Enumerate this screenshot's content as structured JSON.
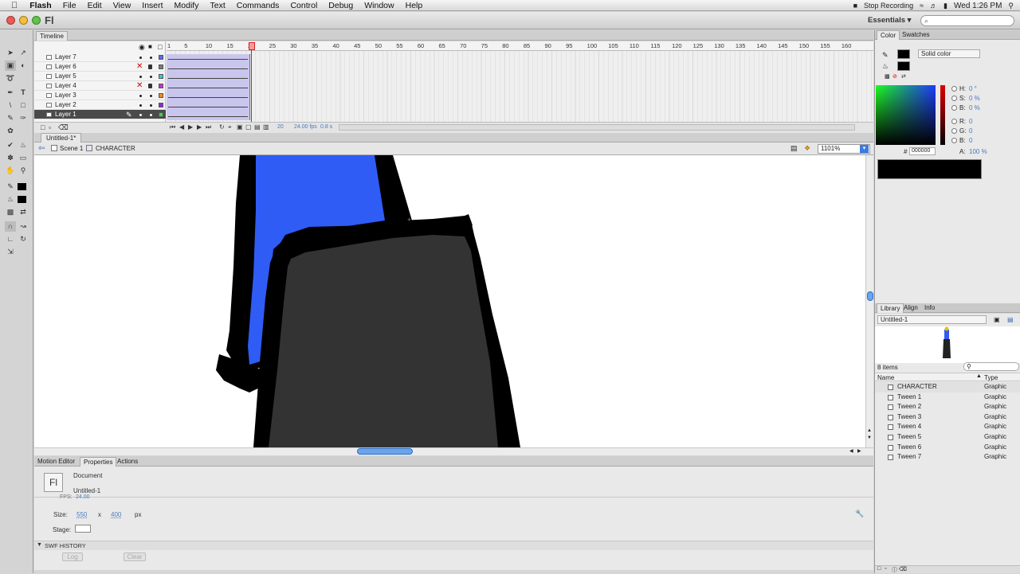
{
  "menubar": {
    "app": "Flash",
    "items": [
      "File",
      "Edit",
      "View",
      "Insert",
      "Modify",
      "Text",
      "Commands",
      "Control",
      "Debug",
      "Window",
      "Help"
    ],
    "recording": "Stop Recording",
    "clock": "Wed 1:26 PM"
  },
  "appbar": {
    "logo": "Fl",
    "workspace": "Essentials ▾",
    "search_placeholder": "⌕"
  },
  "timeline": {
    "tab": "Timeline",
    "layers": [
      {
        "name": "Layer 7",
        "color": "#5a6bf0",
        "hidden": false,
        "locked": false
      },
      {
        "name": "Layer 6",
        "color": "#7a7a7a",
        "hidden": true,
        "locked": true
      },
      {
        "name": "Layer 5",
        "color": "#35c9d8",
        "hidden": false,
        "locked": false
      },
      {
        "name": "Layer 4",
        "color": "#d12ad6",
        "hidden": true,
        "locked": true
      },
      {
        "name": "Layer 3",
        "color": "#f08a2a",
        "hidden": false,
        "locked": false
      },
      {
        "name": "Layer 2",
        "color": "#8a2ad6",
        "hidden": false,
        "locked": false
      },
      {
        "name": "Layer 1",
        "color": "#3ad63a",
        "hidden": false,
        "locked": false,
        "selected": true
      }
    ],
    "ruler_ticks": [
      "1",
      "5",
      "10",
      "15",
      "20",
      "25",
      "30",
      "35",
      "40",
      "45",
      "50",
      "55",
      "60",
      "65",
      "70",
      "75",
      "80",
      "85",
      "90",
      "95",
      "100",
      "105",
      "110",
      "115",
      "120",
      "125",
      "130",
      "135",
      "140",
      "145",
      "150",
      "155",
      "160"
    ],
    "current_frame": "20",
    "fps": "24.00 fps",
    "time": "0.8 s"
  },
  "document": {
    "tab": "Untitled-1*",
    "scene": "Scene 1",
    "symbol": "CHARACTER",
    "zoom": "1101%"
  },
  "properties": {
    "tabs": [
      "Motion Editor",
      "Properties",
      "Actions"
    ],
    "type": "Document",
    "name": "Untitled-1",
    "fps_partial": "FPS:",
    "fps_value": "24.00",
    "size_label": "Size:",
    "width": "550",
    "x_sep": "x",
    "height": "400",
    "unit": "px",
    "stage_label": "Stage:",
    "swf_history": "SWF HISTORY",
    "log_btn": "Log",
    "clear_btn": "Clear"
  },
  "color_panel": {
    "tabs": [
      "Color",
      "Swatches"
    ],
    "type": "Solid color",
    "hsb": [
      {
        "k": "H:",
        "v": "0 °"
      },
      {
        "k": "S:",
        "v": "0 %"
      },
      {
        "k": "B:",
        "v": "0 %"
      }
    ],
    "rgb": [
      {
        "k": "R:",
        "v": "0"
      },
      {
        "k": "G:",
        "v": "0"
      },
      {
        "k": "B:",
        "v": "0"
      }
    ],
    "alpha_label": "A:",
    "alpha": "100 %",
    "hex_hash": "#",
    "hex": "000000"
  },
  "library": {
    "tabs": [
      "Library",
      "Align",
      "Info"
    ],
    "doc": "Untitled-1",
    "count": "8 items",
    "col_name": "Name",
    "col_type": "Type",
    "items": [
      {
        "name": "CHARACTER",
        "type": "Graphic"
      },
      {
        "name": "Tween 1",
        "type": "Graphic"
      },
      {
        "name": "Tween 2",
        "type": "Graphic"
      },
      {
        "name": "Tween 3",
        "type": "Graphic"
      },
      {
        "name": "Tween 4",
        "type": "Graphic"
      },
      {
        "name": "Tween 5",
        "type": "Graphic"
      },
      {
        "name": "Tween 6",
        "type": "Graphic"
      },
      {
        "name": "Tween 7",
        "type": "Graphic"
      }
    ]
  },
  "colors": {
    "stage_blue": "#2f5cf5",
    "stage_dark": "#333333",
    "selected_layer": "#4a4a4a",
    "tween": "#c9c6ee"
  }
}
